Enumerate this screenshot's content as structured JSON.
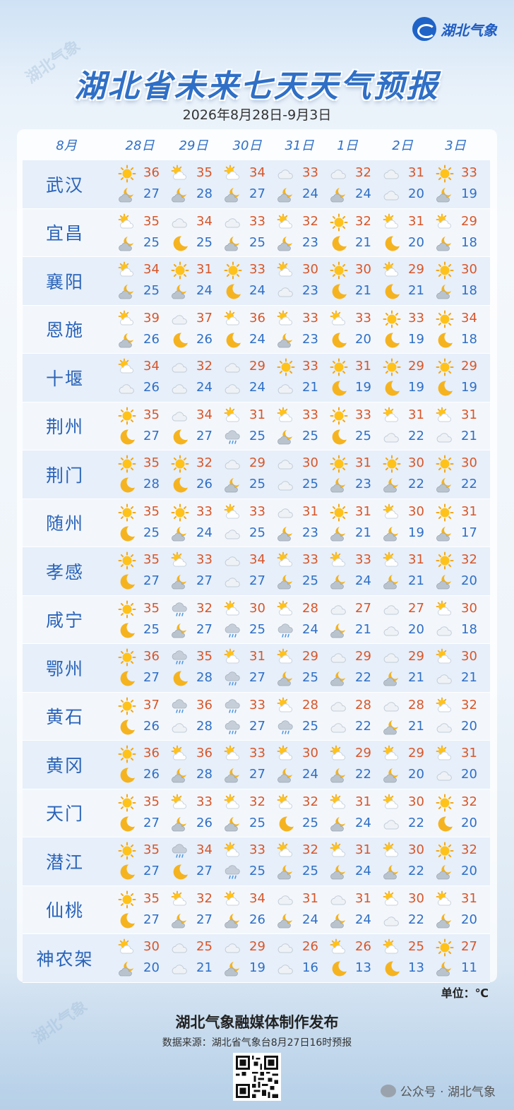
{
  "brand": {
    "name": "湖北气象"
  },
  "title": "湖北省未来七天天气预报",
  "subtitle": "2026年8月28日-9月3日",
  "header": {
    "month": "8月",
    "days": [
      "28日",
      "29日",
      "30日",
      "31日",
      "1日",
      "2日",
      "3日"
    ]
  },
  "rows": [
    {
      "city": "武汉",
      "cells": [
        [
          "sunny",
          "partly-cloudy-night",
          36,
          27
        ],
        [
          "partly-cloudy",
          "partly-cloudy-night",
          35,
          28
        ],
        [
          "partly-cloudy",
          "partly-cloudy-night",
          34,
          27
        ],
        [
          "cloudy",
          "partly-cloudy-night",
          33,
          24
        ],
        [
          "cloudy",
          "partly-cloudy-night",
          32,
          24
        ],
        [
          "cloudy",
          "cloudy",
          31,
          20
        ],
        [
          "sunny",
          "partly-cloudy-night",
          33,
          19
        ]
      ]
    },
    {
      "city": "宜昌",
      "cells": [
        [
          "partly-cloudy",
          "partly-cloudy-night",
          35,
          25
        ],
        [
          "cloudy",
          "clear-night",
          34,
          25
        ],
        [
          "cloudy",
          "partly-cloudy-night",
          33,
          25
        ],
        [
          "partly-cloudy",
          "partly-cloudy-night",
          32,
          23
        ],
        [
          "sunny",
          "clear-night",
          32,
          21
        ],
        [
          "partly-cloudy",
          "clear-night",
          31,
          20
        ],
        [
          "partly-cloudy",
          "partly-cloudy-night",
          29,
          18
        ]
      ]
    },
    {
      "city": "襄阳",
      "cells": [
        [
          "partly-cloudy",
          "partly-cloudy-night",
          34,
          25
        ],
        [
          "sunny",
          "partly-cloudy-night",
          31,
          24
        ],
        [
          "sunny",
          "clear-night",
          33,
          24
        ],
        [
          "partly-cloudy",
          "cloudy",
          30,
          23
        ],
        [
          "sunny",
          "clear-night",
          30,
          21
        ],
        [
          "partly-cloudy",
          "clear-night",
          29,
          21
        ],
        [
          "sunny",
          "partly-cloudy-night",
          30,
          18
        ]
      ]
    },
    {
      "city": "恩施",
      "cells": [
        [
          "partly-cloudy",
          "partly-cloudy-night",
          39,
          26
        ],
        [
          "cloudy",
          "clear-night",
          37,
          26
        ],
        [
          "partly-cloudy",
          "clear-night",
          36,
          24
        ],
        [
          "partly-cloudy",
          "partly-cloudy-night",
          33,
          23
        ],
        [
          "partly-cloudy",
          "clear-night",
          33,
          20
        ],
        [
          "sunny",
          "clear-night",
          33,
          19
        ],
        [
          "sunny",
          "clear-night",
          34,
          18
        ]
      ]
    },
    {
      "city": "十堰",
      "cells": [
        [
          "partly-cloudy",
          "cloudy",
          34,
          26
        ],
        [
          "cloudy",
          "cloudy",
          32,
          24
        ],
        [
          "cloudy",
          "cloudy",
          29,
          24
        ],
        [
          "sunny",
          "cloudy",
          33,
          21
        ],
        [
          "sunny",
          "clear-night",
          31,
          19
        ],
        [
          "sunny",
          "clear-night",
          29,
          19
        ],
        [
          "sunny",
          "clear-night",
          29,
          19
        ]
      ]
    },
    {
      "city": "荆州",
      "cells": [
        [
          "sunny",
          "clear-night",
          35,
          27
        ],
        [
          "cloudy",
          "clear-night",
          34,
          27
        ],
        [
          "partly-cloudy",
          "rain",
          31,
          25
        ],
        [
          "partly-cloudy",
          "partly-cloudy-night",
          33,
          25
        ],
        [
          "sunny",
          "clear-night",
          33,
          25
        ],
        [
          "partly-cloudy",
          "cloudy",
          31,
          22
        ],
        [
          "partly-cloudy",
          "cloudy",
          31,
          21
        ]
      ]
    },
    {
      "city": "荆门",
      "cells": [
        [
          "sunny",
          "clear-night",
          35,
          28
        ],
        [
          "sunny",
          "clear-night",
          32,
          26
        ],
        [
          "cloudy",
          "partly-cloudy-night",
          29,
          25
        ],
        [
          "cloudy",
          "cloudy",
          30,
          25
        ],
        [
          "sunny",
          "partly-cloudy-night",
          31,
          23
        ],
        [
          "sunny",
          "partly-cloudy-night",
          30,
          22
        ],
        [
          "sunny",
          "partly-cloudy-night",
          30,
          22
        ]
      ]
    },
    {
      "city": "随州",
      "cells": [
        [
          "sunny",
          "clear-night",
          35,
          25
        ],
        [
          "sunny",
          "partly-cloudy-night",
          33,
          24
        ],
        [
          "partly-cloudy",
          "cloudy",
          33,
          25
        ],
        [
          "cloudy",
          "partly-cloudy-night",
          31,
          23
        ],
        [
          "sunny",
          "partly-cloudy-night",
          31,
          21
        ],
        [
          "partly-cloudy",
          "partly-cloudy-night",
          30,
          19
        ],
        [
          "sunny",
          "partly-cloudy-night",
          31,
          17
        ]
      ]
    },
    {
      "city": "孝感",
      "cells": [
        [
          "sunny",
          "clear-night",
          35,
          27
        ],
        [
          "partly-cloudy",
          "partly-cloudy-night",
          33,
          27
        ],
        [
          "cloudy",
          "cloudy",
          34,
          27
        ],
        [
          "partly-cloudy",
          "partly-cloudy-night",
          33,
          25
        ],
        [
          "partly-cloudy",
          "partly-cloudy-night",
          33,
          24
        ],
        [
          "partly-cloudy",
          "partly-cloudy-night",
          31,
          21
        ],
        [
          "sunny",
          "partly-cloudy-night",
          32,
          20
        ]
      ]
    },
    {
      "city": "咸宁",
      "cells": [
        [
          "sunny",
          "clear-night",
          35,
          25
        ],
        [
          "rain",
          "partly-cloudy-night",
          32,
          27
        ],
        [
          "partly-cloudy",
          "rain",
          30,
          25
        ],
        [
          "partly-cloudy",
          "rain",
          28,
          24
        ],
        [
          "cloudy",
          "partly-cloudy-night",
          27,
          21
        ],
        [
          "cloudy",
          "cloudy",
          27,
          20
        ],
        [
          "partly-cloudy",
          "cloudy",
          30,
          18
        ]
      ]
    },
    {
      "city": "鄂州",
      "cells": [
        [
          "sunny",
          "clear-night",
          36,
          27
        ],
        [
          "rain",
          "clear-night",
          35,
          28
        ],
        [
          "partly-cloudy",
          "rain",
          31,
          27
        ],
        [
          "partly-cloudy",
          "partly-cloudy-night",
          29,
          25
        ],
        [
          "cloudy",
          "partly-cloudy-night",
          29,
          22
        ],
        [
          "cloudy",
          "partly-cloudy-night",
          29,
          21
        ],
        [
          "partly-cloudy",
          "cloudy",
          30,
          21
        ]
      ]
    },
    {
      "city": "黄石",
      "cells": [
        [
          "sunny",
          "clear-night",
          37,
          26
        ],
        [
          "rain",
          "cloudy",
          36,
          28
        ],
        [
          "rain",
          "rain",
          33,
          27
        ],
        [
          "partly-cloudy",
          "rain",
          28,
          25
        ],
        [
          "cloudy",
          "cloudy",
          28,
          22
        ],
        [
          "cloudy",
          "partly-cloudy-night",
          28,
          21
        ],
        [
          "partly-cloudy",
          "cloudy",
          32,
          20
        ]
      ]
    },
    {
      "city": "黄冈",
      "cells": [
        [
          "sunny",
          "clear-night",
          36,
          26
        ],
        [
          "partly-cloudy",
          "partly-cloudy-night",
          36,
          28
        ],
        [
          "partly-cloudy",
          "partly-cloudy-night",
          33,
          27
        ],
        [
          "partly-cloudy",
          "partly-cloudy-night",
          30,
          24
        ],
        [
          "partly-cloudy",
          "partly-cloudy-night",
          29,
          22
        ],
        [
          "partly-cloudy",
          "partly-cloudy-night",
          29,
          20
        ],
        [
          "partly-cloudy",
          "cloudy",
          31,
          20
        ]
      ]
    },
    {
      "city": "天门",
      "cells": [
        [
          "sunny",
          "clear-night",
          35,
          27
        ],
        [
          "partly-cloudy",
          "partly-cloudy-night",
          33,
          26
        ],
        [
          "partly-cloudy",
          "partly-cloudy-night",
          32,
          25
        ],
        [
          "partly-cloudy",
          "clear-night",
          32,
          25
        ],
        [
          "partly-cloudy",
          "partly-cloudy-night",
          31,
          24
        ],
        [
          "partly-cloudy",
          "cloudy",
          30,
          22
        ],
        [
          "sunny",
          "clear-night",
          32,
          20
        ]
      ]
    },
    {
      "city": "潜江",
      "cells": [
        [
          "sunny",
          "clear-night",
          35,
          27
        ],
        [
          "rain",
          "clear-night",
          34,
          27
        ],
        [
          "partly-cloudy",
          "rain",
          33,
          25
        ],
        [
          "partly-cloudy",
          "partly-cloudy-night",
          32,
          25
        ],
        [
          "partly-cloudy",
          "partly-cloudy-night",
          31,
          24
        ],
        [
          "partly-cloudy",
          "partly-cloudy-night",
          30,
          22
        ],
        [
          "sunny",
          "partly-cloudy-night",
          32,
          20
        ]
      ]
    },
    {
      "city": "仙桃",
      "cells": [
        [
          "sunny",
          "clear-night",
          35,
          27
        ],
        [
          "partly-cloudy",
          "partly-cloudy-night",
          32,
          27
        ],
        [
          "partly-cloudy",
          "partly-cloudy-night",
          34,
          26
        ],
        [
          "cloudy",
          "partly-cloudy-night",
          31,
          24
        ],
        [
          "cloudy",
          "partly-cloudy-night",
          31,
          24
        ],
        [
          "partly-cloudy",
          "cloudy",
          30,
          22
        ],
        [
          "partly-cloudy",
          "partly-cloudy-night",
          31,
          20
        ]
      ]
    },
    {
      "city": "神农架",
      "cells": [
        [
          "partly-cloudy",
          "partly-cloudy-night",
          30,
          20
        ],
        [
          "cloudy",
          "cloudy",
          25,
          21
        ],
        [
          "cloudy",
          "partly-cloudy-night",
          29,
          19
        ],
        [
          "cloudy",
          "cloudy",
          26,
          16
        ],
        [
          "partly-cloudy",
          "clear-night",
          26,
          13
        ],
        [
          "partly-cloudy",
          "clear-night",
          25,
          13
        ],
        [
          "sunny",
          "partly-cloudy-night",
          27,
          11
        ]
      ]
    }
  ],
  "unit": "单位：℃",
  "footer": {
    "title": "湖北气象融媒体制作发布",
    "source": "数据来源：湖北省气象台8月27日16时预报",
    "wechat": "公众号 · 湖北气象"
  },
  "colors": {
    "title": "#2f6fc6",
    "high": "#d8562a",
    "low": "#2f6fc6"
  }
}
